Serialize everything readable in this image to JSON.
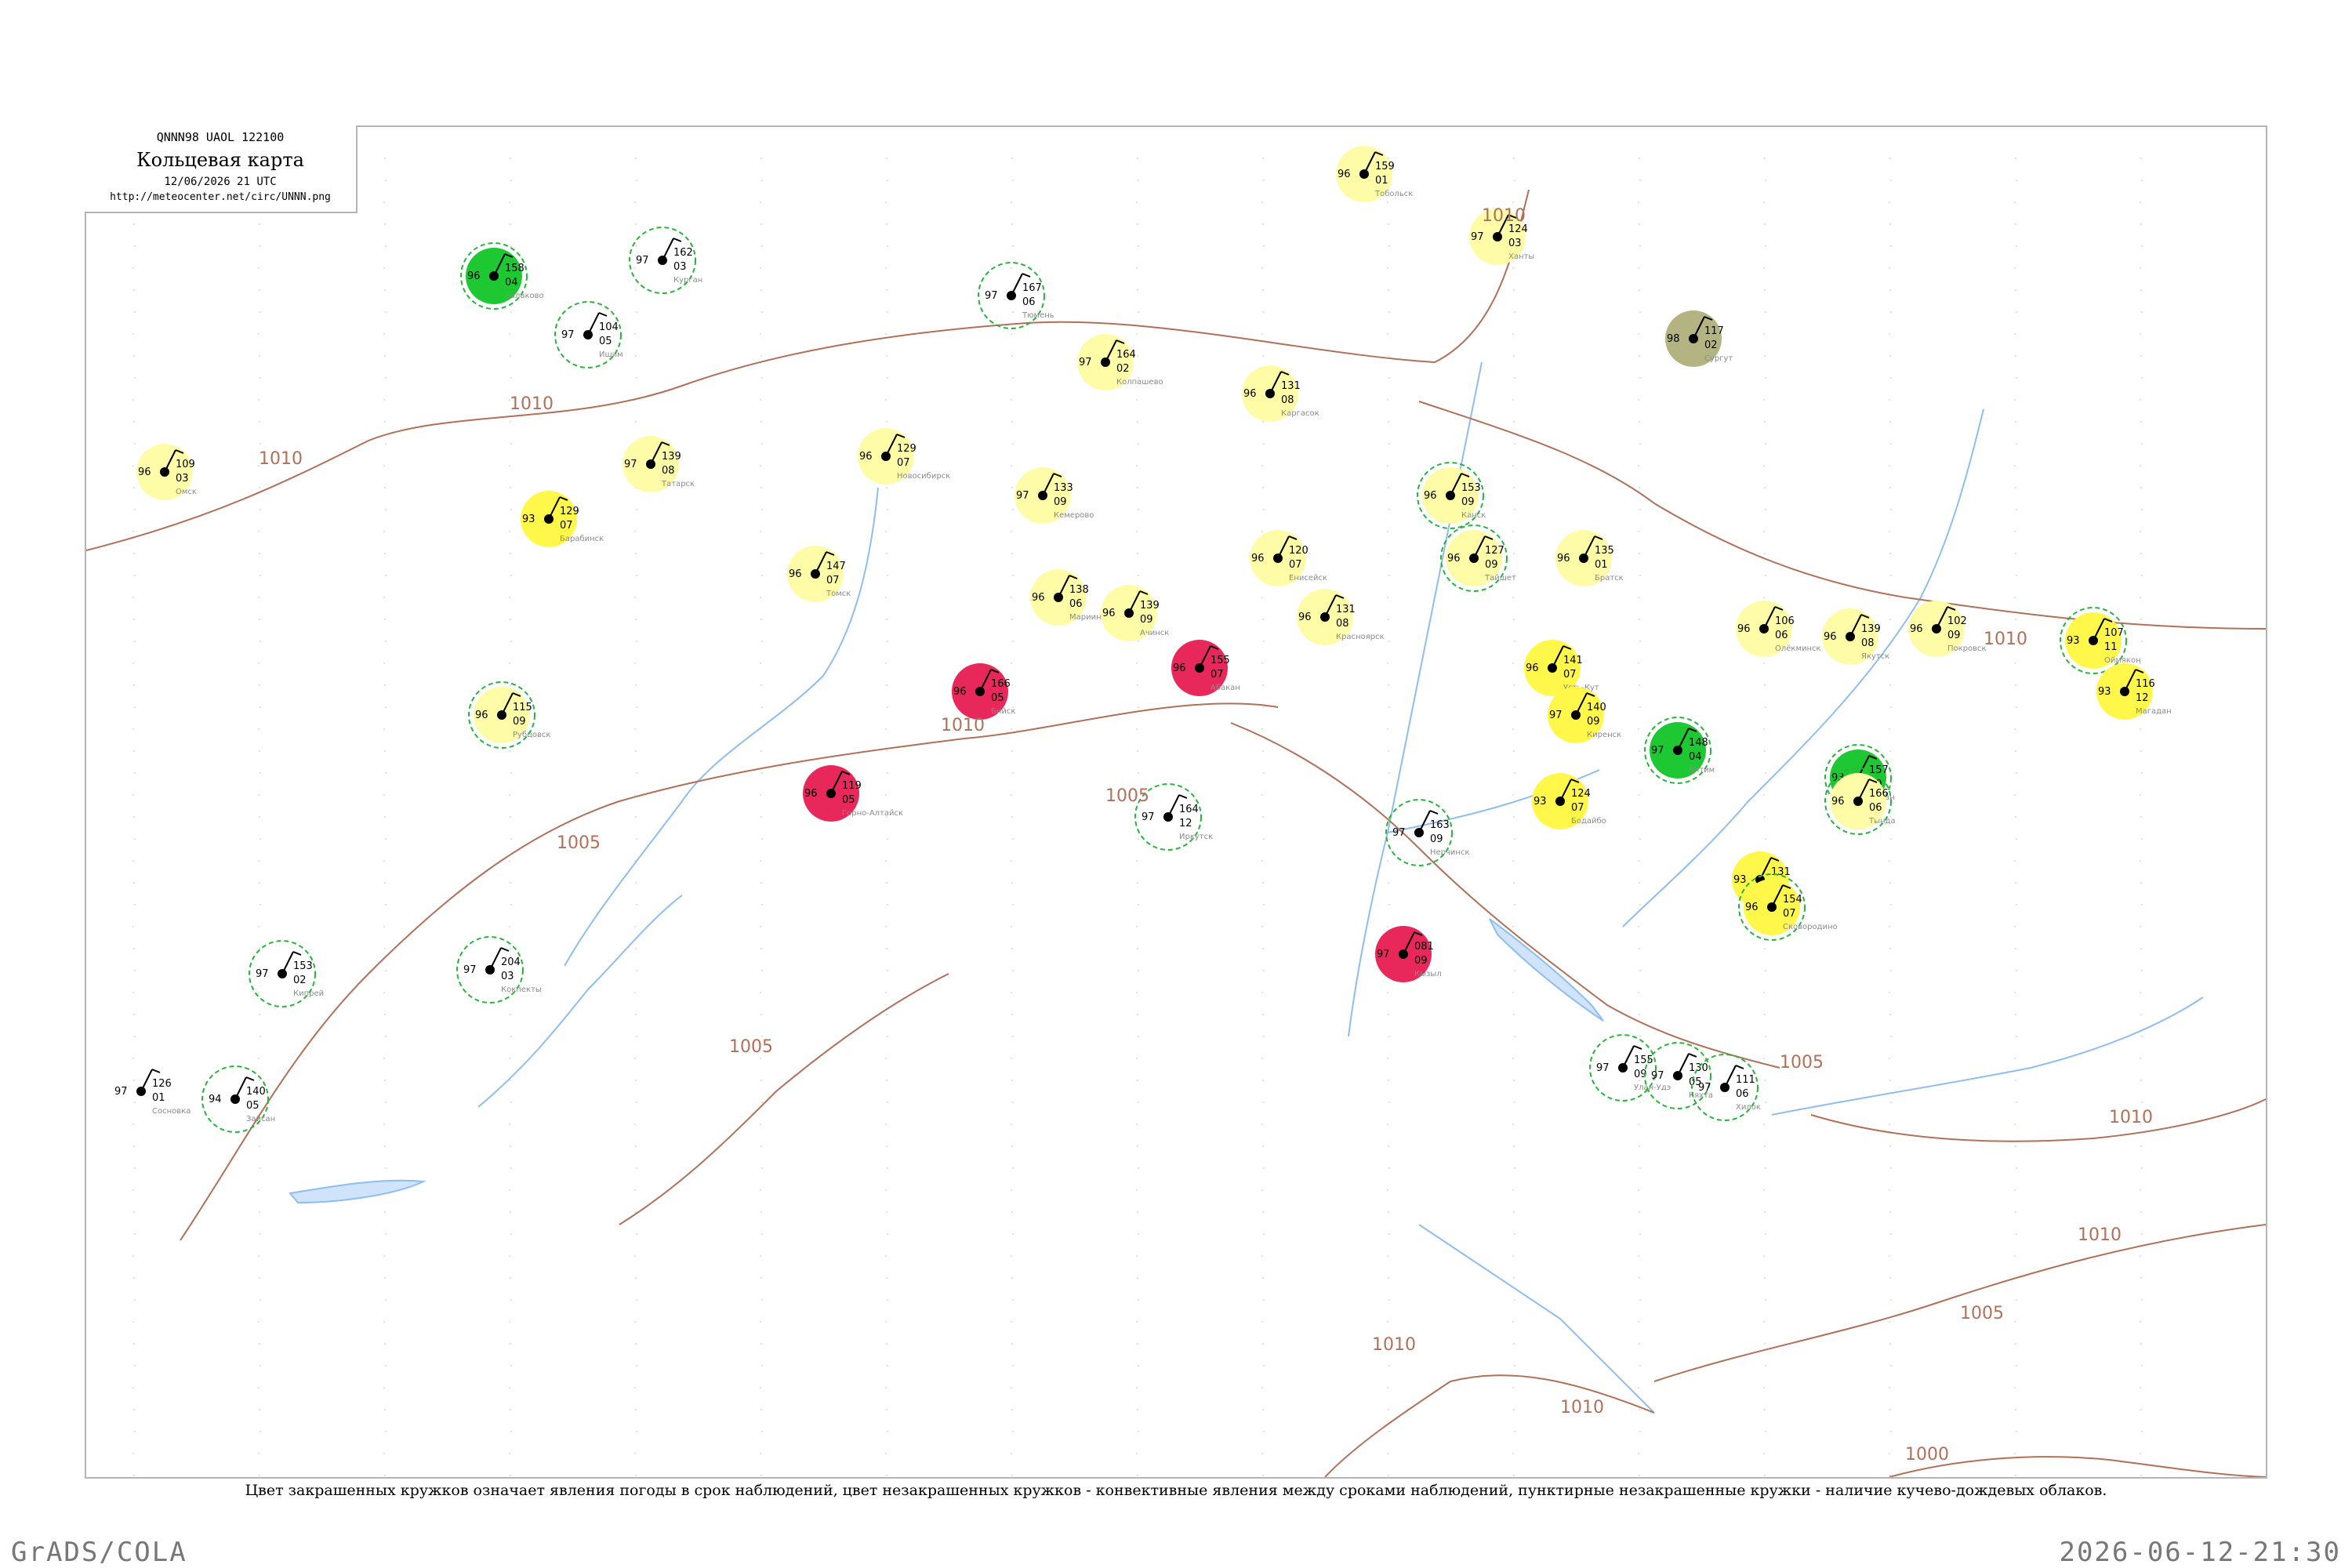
{
  "header": {
    "codes": "QNNN98  UAOL  122100",
    "title": "Кольцевая карта",
    "date": "12/06/2026 21 UTC",
    "url": "http://meteocenter.net/circ/UNNN.png"
  },
  "caption": "Цвет закрашенных кружков означает явления погоды в срок наблюдений, цвет незакрашенных кружков - конвективные явления между сроками наблюдений, пунктирные незакрашенные кружки - наличие кучево-дождевых облаков.",
  "footer": {
    "left": "GrADS/COLA",
    "right": "2026-06-12-21:30"
  },
  "colors": {
    "isobar": "#b0705a",
    "river": "#8fbdf0",
    "green_fill": "#1ec832",
    "yellow_fill": "#fff84a",
    "pale_yellow_fill": "#fffca8",
    "red_fill": "#e8285a",
    "olive_fill": "#b4b482",
    "cb_dashed": "#28b43c",
    "convective_outline": "#d23c3c"
  },
  "isobar_labels": [
    {
      "text": "1010"
    },
    {
      "text": "1010"
    },
    {
      "text": "1010"
    },
    {
      "text": "1005"
    },
    {
      "text": "1005"
    },
    {
      "text": "1010"
    },
    {
      "text": "1005"
    },
    {
      "text": "1010"
    },
    {
      "text": "1005"
    },
    {
      "text": "1010"
    },
    {
      "text": "1010"
    },
    {
      "text": "1005"
    },
    {
      "text": "1010"
    },
    {
      "text": "1000"
    },
    {
      "text": "1010"
    }
  ],
  "stations": [
    {
      "p": "126",
      "t": "97",
      "d": "01",
      "name": "Сосновка",
      "fill": "none",
      "cb": false
    },
    {
      "p": "153",
      "t": "97",
      "d": "02",
      "name": "Кипрей",
      "fill": "none",
      "cb": true
    },
    {
      "p": "158",
      "t": "96",
      "d": "04",
      "name": "Балаково",
      "fill": "green",
      "cb": true
    },
    {
      "p": "104",
      "t": "97",
      "d": "05",
      "name": "Ишим",
      "fill": "none",
      "cb": true
    },
    {
      "p": "162",
      "t": "97",
      "d": "03",
      "name": "Курган",
      "fill": "none",
      "cb": true
    },
    {
      "p": "167",
      "t": "97",
      "d": "06",
      "name": "Тюмень",
      "fill": "none",
      "cb": true
    },
    {
      "p": "159",
      "t": "96",
      "d": "01",
      "name": "Тобольск",
      "fill": "pale",
      "cb": false
    },
    {
      "p": "124",
      "t": "97",
      "d": "03",
      "name": "Ханты",
      "fill": "pale",
      "cb": false
    },
    {
      "p": "117",
      "t": "98",
      "d": "02",
      "name": "Сургут",
      "fill": "olive",
      "cb": false
    },
    {
      "p": "109",
      "t": "96",
      "d": "03",
      "name": "Омск",
      "fill": "pale",
      "cb": false
    },
    {
      "p": "129",
      "t": "93",
      "d": "07",
      "name": "Барабинск",
      "fill": "yellow",
      "cb": false
    },
    {
      "p": "139",
      "t": "97",
      "d": "08",
      "name": "Татарск",
      "fill": "pale",
      "cb": false
    },
    {
      "p": "164",
      "t": "97",
      "d": "02",
      "name": "Колпашево",
      "fill": "pale",
      "cb": false
    },
    {
      "p": "131",
      "t": "96",
      "d": "08",
      "name": "Каргасок",
      "fill": "pale",
      "cb": false
    },
    {
      "p": "129",
      "t": "96",
      "d": "07",
      "name": "Новосибирск",
      "fill": "pale",
      "cb": false
    },
    {
      "p": "147",
      "t": "96",
      "d": "07",
      "name": "Томск",
      "fill": "pale",
      "cb": false
    },
    {
      "p": "133",
      "t": "97",
      "d": "09",
      "name": "Кемерово",
      "fill": "pale",
      "cb": false
    },
    {
      "p": "138",
      "t": "96",
      "d": "06",
      "name": "Мариинск",
      "fill": "pale",
      "cb": false
    },
    {
      "p": "139",
      "t": "96",
      "d": "09",
      "name": "Ачинск",
      "fill": "pale",
      "cb": false
    },
    {
      "p": "120",
      "t": "96",
      "d": "07",
      "name": "Енисейск",
      "fill": "pale",
      "cb": false
    },
    {
      "p": "131",
      "t": "96",
      "d": "08",
      "name": "Красноярск",
      "fill": "pale",
      "cb": false
    },
    {
      "p": "153",
      "t": "96",
      "d": "09",
      "name": "Канск",
      "fill": "pale",
      "cb": true
    },
    {
      "p": "127",
      "t": "96",
      "d": "09",
      "name": "Тайшет",
      "fill": "pale",
      "cb": true
    },
    {
      "p": "135",
      "t": "96",
      "d": "01",
      "name": "Братск",
      "fill": "pale",
      "cb": false
    },
    {
      "p": "141",
      "t": "96",
      "d": "07",
      "name": "Усть-Кут",
      "fill": "yellow",
      "cb": false
    },
    {
      "p": "140",
      "t": "97",
      "d": "09",
      "name": "Киренск",
      "fill": "yellow",
      "cb": false
    },
    {
      "p": "124",
      "t": "93",
      "d": "07",
      "name": "Бодайбо",
      "fill": "yellow",
      "cb": false
    },
    {
      "p": "148",
      "t": "97",
      "d": "04",
      "name": "Витим",
      "fill": "green",
      "cb": true
    },
    {
      "p": "106",
      "t": "96",
      "d": "06",
      "name": "Олёкминск",
      "fill": "pale",
      "cb": false
    },
    {
      "p": "139",
      "t": "96",
      "d": "08",
      "name": "Якутск",
      "fill": "pale",
      "cb": false
    },
    {
      "p": "102",
      "t": "96",
      "d": "09",
      "name": "Покровск",
      "fill": "pale",
      "cb": false
    },
    {
      "p": "107",
      "t": "93",
      "d": "11",
      "name": "Оймякон",
      "fill": "yellow",
      "cb": true
    },
    {
      "p": "116",
      "t": "93",
      "d": "12",
      "name": "Магадан",
      "fill": "yellow",
      "cb": false
    },
    {
      "p": "157",
      "t": "93",
      "d": "10",
      "name": "Алдан",
      "fill": "green",
      "cb": true
    },
    {
      "p": "166",
      "t": "96",
      "d": "06",
      "name": "Тында",
      "fill": "pale",
      "cb": true
    },
    {
      "p": "131",
      "t": "93",
      "d": "06",
      "name": "Чита",
      "fill": "yellow",
      "cb": false
    },
    {
      "p": "154",
      "t": "96",
      "d": "07",
      "name": "Сковородино",
      "fill": "yellow",
      "cb": true
    },
    {
      "p": "166",
      "t": "96",
      "d": "05",
      "name": "Бийск",
      "fill": "red",
      "cb": false
    },
    {
      "p": "119",
      "t": "96",
      "d": "05",
      "name": "Горно-Алтайск",
      "fill": "red",
      "cb": false
    },
    {
      "p": "155",
      "t": "96",
      "d": "07",
      "name": "Абакан",
      "fill": "red",
      "cb": false
    },
    {
      "p": "081",
      "t": "97",
      "d": "09",
      "name": "Кызыл",
      "fill": "red",
      "cb": false
    },
    {
      "p": "115",
      "t": "96",
      "d": "09",
      "name": "Рубцовск",
      "fill": "pale",
      "cb": true
    },
    {
      "p": "164",
      "t": "97",
      "d": "12",
      "name": "Иркутск",
      "fill": "none",
      "cb": true
    },
    {
      "p": "204",
      "t": "97",
      "d": "03",
      "name": "Кокпекты",
      "fill": "none",
      "cb": true
    },
    {
      "p": "140",
      "t": "94",
      "d": "05",
      "name": "Зайсан",
      "fill": "none",
      "cb": true
    },
    {
      "p": "155",
      "t": "97",
      "d": "09",
      "name": "Улан-Удэ",
      "fill": "none",
      "cb": true
    },
    {
      "p": "130",
      "t": "97",
      "d": "05",
      "name": "Кяхта",
      "fill": "none",
      "cb": true
    },
    {
      "p": "111",
      "t": "97",
      "d": "06",
      "name": "Хилок",
      "fill": "none",
      "cb": true
    },
    {
      "p": "163",
      "t": "97",
      "d": "09",
      "name": "Нерчинск",
      "fill": "none",
      "cb": true
    }
  ]
}
